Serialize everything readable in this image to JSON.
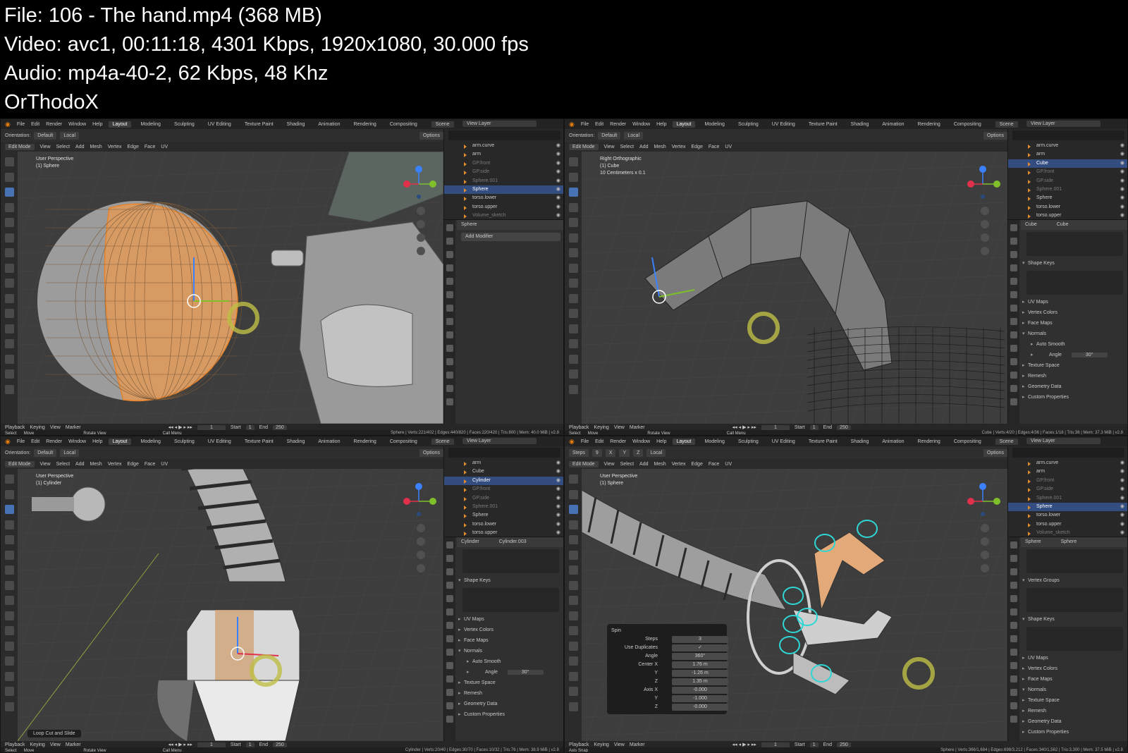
{
  "header": {
    "line1": "File: 106 - The hand.mp4 (368 MB)",
    "line2": "Video: avc1, 00:11:18, 4301 Kbps, 1920x1080, 30.000 fps",
    "line3": "Audio: mp4a-40-2, 62 Kbps, 48 Khz",
    "line4": "OrThodoX"
  },
  "topbar": {
    "menus": [
      "File",
      "Edit",
      "Render",
      "Window",
      "Help"
    ],
    "workspaces": [
      "Layout",
      "Modeling",
      "Sculpting",
      "UV Editing",
      "Texture Paint",
      "Shading",
      "Animation",
      "Rendering",
      "Compositing"
    ],
    "scene": "Scene",
    "view_layer": "View Layer"
  },
  "tool_header": {
    "orientation_label": "Orientation:",
    "orientation_value": "Default",
    "pivot": "Local",
    "options": "Options",
    "axes": [
      "X",
      "Y",
      "Z"
    ]
  },
  "viewport_header": {
    "mode": "Edit Mode",
    "menus": [
      "View",
      "Select",
      "Add",
      "Mesh",
      "Vertex",
      "Edge",
      "Face",
      "UV"
    ]
  },
  "timeline": {
    "menus": [
      "Playback",
      "Keying",
      "View",
      "Marker"
    ],
    "frame": "1",
    "start_label": "Start",
    "start": "1",
    "end_label": "End",
    "end": "250"
  },
  "status_common": {
    "select": "Select",
    "move": "Move",
    "rotate": "Rotate View",
    "call_menu": "Call Menu"
  },
  "panes": [
    {
      "view_name": "User Perspective",
      "object": "(1) Sphere",
      "scale": "",
      "outliner": [
        {
          "name": "arm.curve",
          "sel": false,
          "dim": false
        },
        {
          "name": "arm",
          "sel": false,
          "dim": false
        },
        {
          "name": "GP.front",
          "sel": false,
          "dim": true
        },
        {
          "name": "GP.side",
          "sel": false,
          "dim": true
        },
        {
          "name": "Sphere.001",
          "sel": false,
          "dim": true
        },
        {
          "name": "Sphere",
          "sel": true,
          "dim": false
        },
        {
          "name": "torso.lower",
          "sel": false,
          "dim": false
        },
        {
          "name": "torso.upper",
          "sel": false,
          "dim": false
        },
        {
          "name": "Volume_sketch",
          "sel": false,
          "dim": true
        }
      ],
      "props_header": "Sphere",
      "props_add_modifier": "Add Modifier",
      "status_stats": "Sphere | Verts:221/402 | Edges:440/820 | Faces:220/420 | Tris:800 | Mem: 40.0 MiB | v2.8"
    },
    {
      "view_name": "Right Orthographic",
      "object": "(1) Cube",
      "scale": "10 Centimeters x 0.1",
      "outliner": [
        {
          "name": "arm.curve",
          "sel": false,
          "dim": false
        },
        {
          "name": "arm",
          "sel": false,
          "dim": false
        },
        {
          "name": "Cube",
          "sel": true,
          "dim": false
        },
        {
          "name": "GP.front",
          "sel": false,
          "dim": true
        },
        {
          "name": "GP.side",
          "sel": false,
          "dim": true
        },
        {
          "name": "Sphere.001",
          "sel": false,
          "dim": true
        },
        {
          "name": "Sphere",
          "sel": false,
          "dim": false
        },
        {
          "name": "torso.lower",
          "sel": false,
          "dim": false
        },
        {
          "name": "torso.upper",
          "sel": false,
          "dim": false
        }
      ],
      "props_header": "Cube",
      "props_header2": "Cube",
      "props_sections": [
        "Shape Keys",
        "UV Maps",
        "Vertex Colors",
        "Face Maps",
        "Normals",
        "Auto Smooth",
        "Texture Space",
        "Remesh",
        "Geometry Data",
        "Custom Properties"
      ],
      "angle_label": "Angle",
      "angle_value": "30°",
      "status_stats": "Cube | Verts:4/20 | Edges:4/36 | Faces:1/18 | Tris:36 | Mem: 37.3 MiB | v2.8"
    },
    {
      "view_name": "User Perspective",
      "object": "(1) Cylinder",
      "scale": "",
      "outliner": [
        {
          "name": "arm",
          "sel": false,
          "dim": false
        },
        {
          "name": "Cube",
          "sel": false,
          "dim": false
        },
        {
          "name": "Cylinder",
          "sel": true,
          "dim": false
        },
        {
          "name": "GP.front",
          "sel": false,
          "dim": true
        },
        {
          "name": "GP.side",
          "sel": false,
          "dim": true
        },
        {
          "name": "Sphere.001",
          "sel": false,
          "dim": true
        },
        {
          "name": "Sphere",
          "sel": false,
          "dim": false
        },
        {
          "name": "torso.lower",
          "sel": false,
          "dim": false
        },
        {
          "name": "torso.upper",
          "sel": false,
          "dim": false
        }
      ],
      "props_header": "Cylinder",
      "props_header2": "Cylinder.003",
      "props_sections": [
        "Shape Keys",
        "UV Maps",
        "Vertex Colors",
        "Face Maps",
        "Normals",
        "Auto Smooth",
        "Texture Space",
        "Remesh",
        "Geometry Data",
        "Custom Properties"
      ],
      "angle_label": "Angle",
      "angle_value": "30°",
      "loop_cut": "Loop Cut and Slide",
      "status_stats": "Cylinder | Verts:20/40 | Edges:30/70 | Faces:10/32 | Tris:76 | Mem: 38.9 MiB | v2.8"
    },
    {
      "view_name": "User Perspective",
      "object": "(1) Sphere",
      "scale": "",
      "steps_label": "Steps",
      "steps_value": "9",
      "outliner": [
        {
          "name": "arm.curve",
          "sel": false,
          "dim": false
        },
        {
          "name": "arm",
          "sel": false,
          "dim": false
        },
        {
          "name": "GP.front",
          "sel": false,
          "dim": true
        },
        {
          "name": "GP.side",
          "sel": false,
          "dim": true
        },
        {
          "name": "Sphere.001",
          "sel": false,
          "dim": true
        },
        {
          "name": "Sphere",
          "sel": true,
          "dim": false
        },
        {
          "name": "torso.lower",
          "sel": false,
          "dim": false
        },
        {
          "name": "torso.upper",
          "sel": false,
          "dim": false
        },
        {
          "name": "Volume_sketch",
          "sel": false,
          "dim": true
        }
      ],
      "props_header": "Sphere",
      "props_header2": "Sphere",
      "props_sections": [
        "Vertex Groups",
        "Shape Keys",
        "UV Maps",
        "Vertex Colors",
        "Face Maps",
        "Normals",
        "Texture Space",
        "Remesh",
        "Geometry Data",
        "Custom Properties"
      ],
      "spin": {
        "title": "Spin",
        "rows": [
          {
            "label": "Steps",
            "value": "3"
          },
          {
            "label": "Use Duplicates",
            "value": "✓"
          },
          {
            "label": "Angle",
            "value": "360°"
          },
          {
            "label": "Center X",
            "value": "1.76 m"
          },
          {
            "label": "Y",
            "value": "-1.26 m"
          },
          {
            "label": "Z",
            "value": "1.35 m"
          },
          {
            "label": "Axis X",
            "value": "-0.000"
          },
          {
            "label": "Y",
            "value": "-1.000"
          },
          {
            "label": "Z",
            "value": "-0.000"
          }
        ]
      },
      "status_left": "Axis Snap",
      "status_stats": "Sphere | Verts:366/1,684 | Edges:698/3,212 | Faces:340/1,562 | Tris:3,300 | Mem: 37.5 MiB | v2.8"
    }
  ],
  "colors": {
    "selection_orange": "#e08b2c",
    "selection_blue": "#334d80",
    "active_tool": "#4772b3",
    "cursor_ring": "#bebe46",
    "mesh_cyan": "#2fd6d6"
  }
}
